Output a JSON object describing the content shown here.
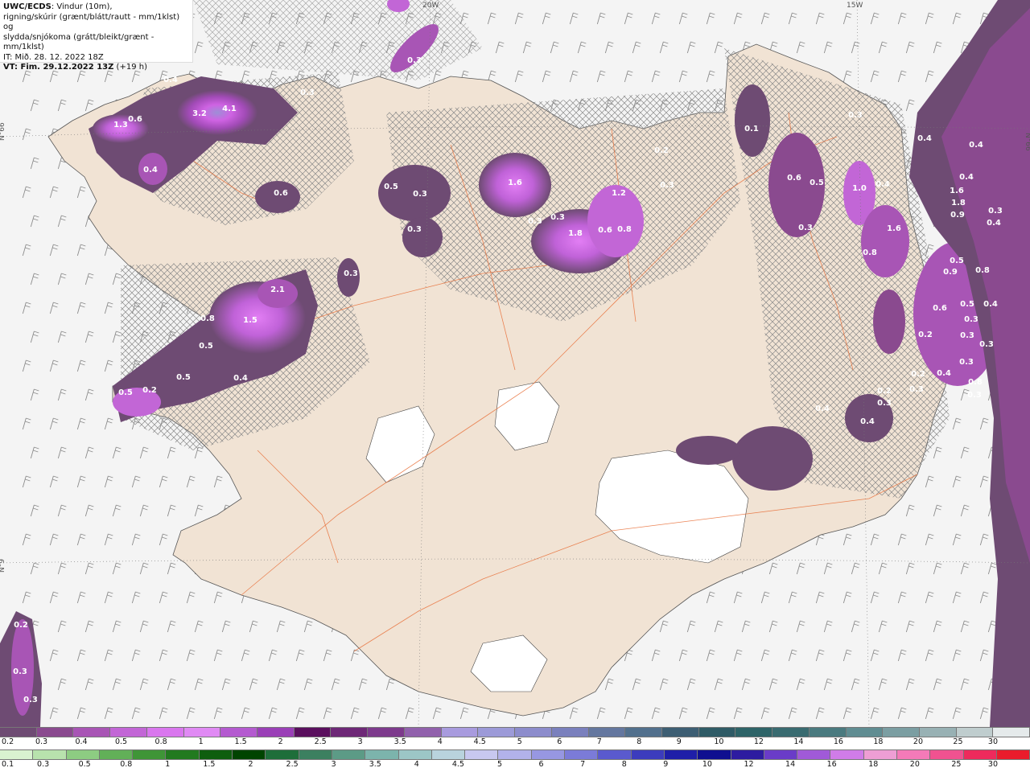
{
  "header": {
    "model": "UWC/ECDS",
    "line1_rest": ": Vindur (10m),",
    "line2": "rigning/skúrir (grænt/blátt/rautt - mm/1klst) og",
    "line3": "slydda/snjókoma (grátt/bleikt/grænt - mm/1klst)",
    "issue": "IT: Mið. 28. 12. 2022 18Z",
    "valid": "VT: Fim. 29.12.2022 13Z",
    "lead": " (+19 h)"
  },
  "map": {
    "lat_labels": [
      "N°66",
      "N°66",
      "N°9"
    ],
    "lon_labels": [
      "20W",
      "15W"
    ],
    "precip_values": [
      "0.4",
      "4.1",
      "3.2",
      "0.3",
      "0.6",
      "1.3",
      "0.4",
      "0.6",
      "0.3",
      "0.5",
      "0.3",
      "0.3",
      "1.6",
      "0.3",
      "0.3",
      "1.2",
      "1.8",
      "0.6",
      "0.8",
      "0.2",
      "0.3",
      "0.3",
      "2.1",
      "0.8",
      "1.5",
      "0.5",
      "0.5",
      "0.2",
      "0.5",
      "0.4",
      "0.1",
      "0.6",
      "0.5",
      "0.3",
      "0.3",
      "1.0",
      "0.4",
      "1.6",
      "0.8",
      "0.5",
      "0.8",
      "0.9",
      "0.6",
      "0.5",
      "0.4",
      "0.3",
      "0.3",
      "0.3",
      "0.2",
      "0.2",
      "0.4",
      "0.3",
      "0.8",
      "0.3",
      "0.3",
      "0.2",
      "0.3",
      "0.4",
      "0.4",
      "0.4",
      "0.4",
      "0.4",
      "1.6",
      "1.8",
      "0.9",
      "0.3",
      "0.4",
      "0.2",
      "0.3",
      "0.3"
    ]
  },
  "legend": {
    "snow_colors": [
      "#6e4b73",
      "#8a4a8f",
      "#a855b5",
      "#c266d6",
      "#d977ee",
      "#e08af4",
      "#b45ad0",
      "#9a3fb7",
      "#5a0f5e",
      "#6e2877",
      "#7d3a8c",
      "#9161ac",
      "#a89bde",
      "#9c9ad8",
      "#8c8ccc",
      "#7a80bd",
      "#64779f",
      "#52708d",
      "#3d5e73",
      "#2f5b66",
      "#2e6468",
      "#396b70",
      "#4a7a7f",
      "#608d92",
      "#7b9ea2",
      "#98b1b4",
      "#bfcdce",
      "#e5eaeb"
    ],
    "snow_ticks": [
      "0.2",
      "0.3",
      "0.4",
      "0.5",
      "0.8",
      "1",
      "1.5",
      "2",
      "2.5",
      "3",
      "3.5",
      "4",
      "4.5",
      "5",
      "6",
      "7",
      "8",
      "9",
      "10",
      "12",
      "14",
      "16",
      "18",
      "20",
      "25",
      "30"
    ],
    "rain_colors": [
      "#d9f2d0",
      "#b8e2ad",
      "#8dcc82",
      "#62b058",
      "#3f9537",
      "#227a1f",
      "#0e5e0e",
      "#004400",
      "#1e6e3a",
      "#3c8060",
      "#5c9b86",
      "#7cb4ac",
      "#9cc6c6",
      "#b9d3dd",
      "#c8c8ef",
      "#b2b2ea",
      "#9797e2",
      "#7b7bd8",
      "#5a5ace",
      "#3c3cbd",
      "#1e1ea8",
      "#0f0f90",
      "#2d1ca0",
      "#6a3cc8",
      "#a05ad8",
      "#d07ce8",
      "#ee9ed4",
      "#f47ab8",
      "#f05290",
      "#ee2a5c",
      "#ea1c2c"
    ],
    "rain_ticks": [
      "0.1",
      "0.3",
      "0.5",
      "0.8",
      "1",
      "1.5",
      "2",
      "2.5",
      "3",
      "3.5",
      "4",
      "4.5",
      "5",
      "6",
      "7",
      "8",
      "9",
      "10",
      "12",
      "14",
      "16",
      "18",
      "20",
      "25",
      "30"
    ]
  }
}
